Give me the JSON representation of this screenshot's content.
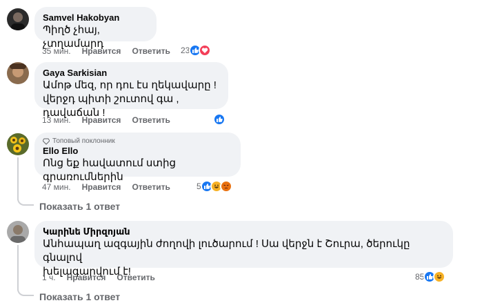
{
  "comments": [
    {
      "author": "Samvel Hakobyan",
      "text_lines": [
        "Պիղծ չհայ, չտղամարդ"
      ],
      "time": "35 мин.",
      "like_label": "Нравится",
      "reply_label": "Ответить",
      "reaction_count": "23",
      "reactions": [
        "like-icon",
        "love-icon"
      ]
    },
    {
      "author": "Gaya Sarkisian",
      "text_lines": [
        "Ամոթ մեզ, որ դու էս ղեկավարը !",
        "վերջդ պիտի շուտով գա , դավաճան !"
      ],
      "time": "13 мин.",
      "like_label": "Нравится",
      "reply_label": "Ответить",
      "reaction_count": "",
      "reactions": [
        "like-icon"
      ]
    },
    {
      "badge": "Топовый поклонник",
      "author": "Ello Ello",
      "text_lines": [
        "Ոնց եք հավատում ստից գրառումներին"
      ],
      "time": "47 мин.",
      "like_label": "Нравится",
      "reply_label": "Ответить",
      "reaction_count": "5",
      "reactions": [
        "like-icon",
        "haha-icon",
        "angry-icon"
      ],
      "show_replies": "Показать 1 ответ"
    },
    {
      "author": "Կարինե Միրզոյան",
      "text_lines": [
        "Անհապաղ ազգային ժողովի լուծարում ! Սա վերջն է Շուրա, ծերուկը գնալով",
        "խելագարվում է!"
      ],
      "time": "1 ч.",
      "like_label": "Нравится",
      "reply_label": "Ответить",
      "reaction_count": "85",
      "reactions": [
        "like-icon",
        "haha-icon"
      ],
      "show_replies": "Показать 1 ответ"
    }
  ],
  "colors": {
    "bubble": "#f0f2f5",
    "like": "#1877f2",
    "love": "#f33e58",
    "haha": "#f7b125",
    "angry": "#e9710f",
    "meta": "#65676b"
  }
}
